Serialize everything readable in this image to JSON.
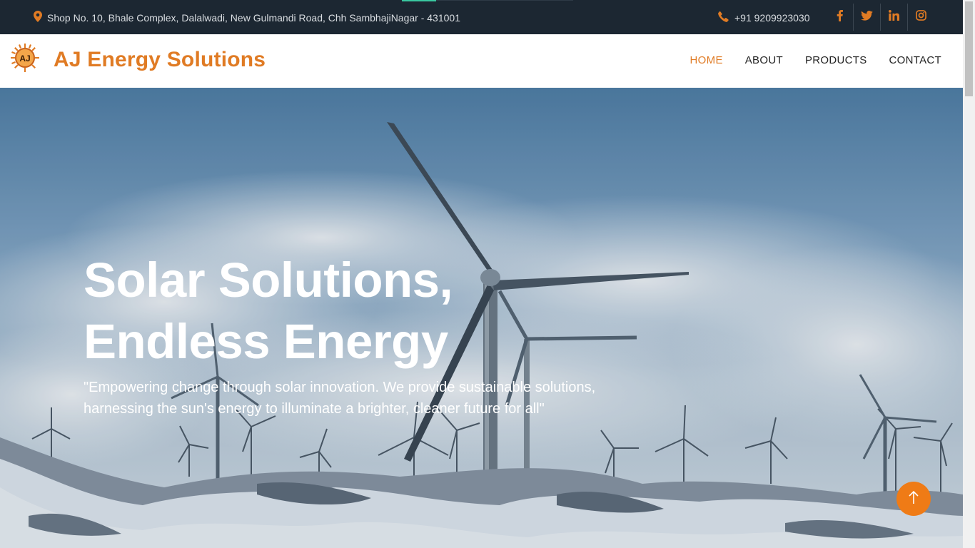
{
  "topbar": {
    "address": "Shop No. 10, Bhale Complex, Dalalwadi, New Gulmandi Road, Chh SambhajiNagar - 431001",
    "phone": "+91 9209923030",
    "socials": [
      "facebook-icon",
      "twitter-icon",
      "linkedin-icon",
      "instagram-icon"
    ]
  },
  "brand": {
    "logo_text": "AJ",
    "name": "AJ Energy Solutions"
  },
  "nav": {
    "home": "HOME",
    "about": "ABOUT",
    "products": "PRODUCTS",
    "contact": "CONTACT"
  },
  "hero": {
    "title_line1": "Solar Solutions,",
    "title_line2": "Endless Energy",
    "subtitle": "\"Empowering change through solar innovation. We provide sustainable solutions, harnessing the sun's energy to illuminate a brighter, cleaner future for all\""
  },
  "colors": {
    "accent": "#e07b24",
    "topbar": "#1c2732",
    "scroll_button": "#ef7b16"
  }
}
